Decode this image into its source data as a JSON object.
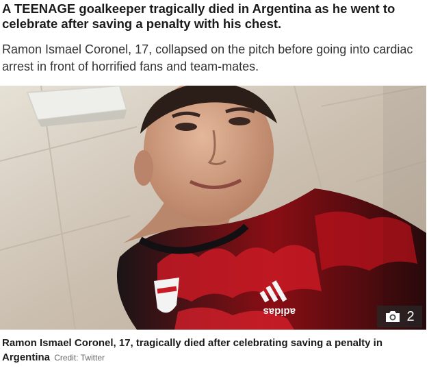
{
  "article": {
    "headline": "A TEENAGE goalkeeper tragically died in Argentina as he went to celebrate after saving a penalty with his chest.",
    "standfirst": "Ramon Ismael Coronel, 17, collapsed on the pitch before going into cardiac arrest in front of horrified fans and team-mates.",
    "photo": {
      "gallery_icon": "camera-icon",
      "gallery_count": "2",
      "shirt_text": "adidas"
    },
    "caption": {
      "text": "Ramon Ismael Coronel, 17, tragically died after celebrating saving a penalty in Argentina",
      "credit": "Credit: Twitter"
    }
  }
}
